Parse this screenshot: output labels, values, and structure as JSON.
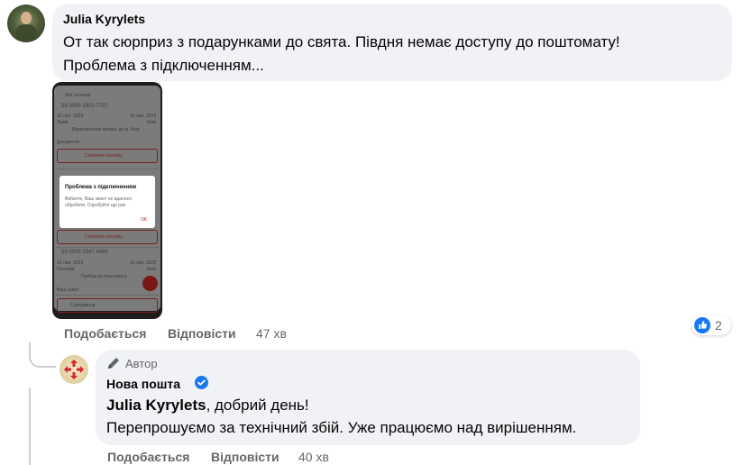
{
  "comment1": {
    "author": "Julia Kyrylets",
    "lines": [
      "От так сюрприз з подарунками до свята. Півдня немає доступу до поштомату!",
      "Проблема з підключенням..."
    ],
    "actions": {
      "like": "Подобається",
      "reply": "Відповісти",
      "time": "47 хв"
    },
    "reaction_count": "2",
    "photo": {
      "header": "Мої посилки",
      "tracking1": "59 0009 2910 7727",
      "date1a": "16 лип. 2023",
      "date1b": "16 лип. 2023",
      "city1a": "Львів",
      "city1b": "Київ",
      "status1": "Відправлення прямує до м. Київ",
      "docs": "Документи",
      "pay_button": "Сплатити посилку",
      "dialog_title": "Проблема з підключенням",
      "dialog_text_line1": "Вибачте, Ваш запит не вдалося",
      "dialog_text_line2": "обробити. Спробуйте ще раз",
      "dialog_ok": "OK",
      "tracking2": "59 0009 2847 4084",
      "date2a": "14 лип. 2023",
      "date2b": "16 лип. 2023",
      "city2a": "Полтава",
      "city2b": "Київ",
      "status2": "Прибув до поштомату",
      "field_label": "Ваш запит",
      "bottom_text": "Сортування"
    }
  },
  "comment2": {
    "badge": "Автор",
    "author": "Нова пошта",
    "mention": "Julia Kyrylets",
    "greeting_rest": ", добрий день!",
    "line2": "Перепрошуємо за технічний збій. Уже працюємо над вирішенням.",
    "actions": {
      "like": "Подобається",
      "reply": "Відповісти",
      "time": "40 хв"
    }
  },
  "colors": {
    "accent": "#1877f2",
    "bubble": "#f0f2f5",
    "secondary_text": "#65676b"
  }
}
